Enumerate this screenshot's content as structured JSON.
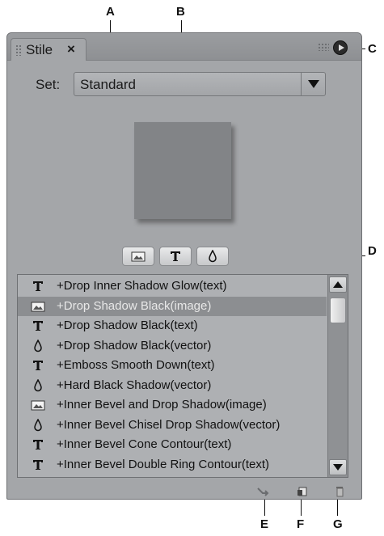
{
  "callouts": {
    "a": "A",
    "b": "B",
    "c": "C",
    "d": "D",
    "e": "E",
    "f": "F",
    "g": "G"
  },
  "panel": {
    "tab_title": "Stile",
    "tab_close": "×"
  },
  "set": {
    "label": "Set:",
    "value": "Standard"
  },
  "filters": [
    {
      "icon": "image-filter-icon"
    },
    {
      "icon": "text-filter-icon"
    },
    {
      "icon": "vector-filter-icon"
    }
  ],
  "styles": [
    {
      "icon": "text-style-icon",
      "label": "+Drop Inner Shadow Glow(text)"
    },
    {
      "icon": "image-style-icon",
      "label": "+Drop Shadow Black(image)",
      "selected": true
    },
    {
      "icon": "text-style-icon",
      "label": "+Drop Shadow Black(text)"
    },
    {
      "icon": "vector-style-icon",
      "label": "+Drop Shadow Black(vector)"
    },
    {
      "icon": "text-style-icon",
      "label": "+Emboss Smooth Down(text)"
    },
    {
      "icon": "vector-style-icon",
      "label": "+Hard Black Shadow(vector)"
    },
    {
      "icon": "image-style-icon",
      "label": "+Inner Bevel and Drop Shadow(image)"
    },
    {
      "icon": "vector-style-icon",
      "label": "+Inner Bevel Chisel Drop Shadow(vector)"
    },
    {
      "icon": "text-style-icon",
      "label": "+Inner Bevel Cone Contour(text)"
    },
    {
      "icon": "text-style-icon",
      "label": "+Inner Bevel Double Ring Contour(text)"
    }
  ],
  "colors": {
    "panel": "#a4a6a9",
    "list": "#aeb0b3",
    "selected_row": "#8c8e91",
    "preview": "#828487"
  }
}
